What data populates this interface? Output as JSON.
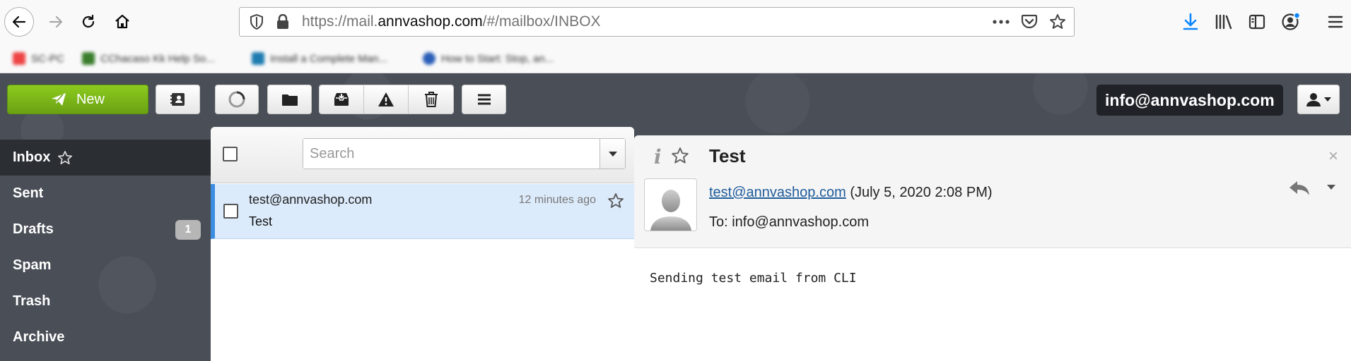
{
  "browser": {
    "url_prefix": "https://mail.",
    "url_domain": "annvashop.com",
    "url_suffix": "/#/mailbox/INBOX",
    "bookmarks": [
      {
        "label": "SC-PC",
        "color": "#e44"
      },
      {
        "label": "CChacaso Kk Help So...",
        "color": "#3a7d2c"
      },
      {
        "label": "Install a Complete Man...",
        "color": "#1d7bb0"
      },
      {
        "label": "How to Start: Stop, an...",
        "color": "#2b5fb8"
      }
    ]
  },
  "toolbar": {
    "new_label": "New",
    "account_email": "info@annvashop.com"
  },
  "sidebar": {
    "folders": [
      {
        "label": "Inbox"
      },
      {
        "label": "Sent"
      },
      {
        "label": "Drafts",
        "badge": "1"
      },
      {
        "label": "Spam"
      },
      {
        "label": "Trash"
      },
      {
        "label": "Archive"
      }
    ]
  },
  "message_list": {
    "search_placeholder": "Search",
    "messages": [
      {
        "from": "test@annvashop.com",
        "subject": "Test",
        "time": "12 minutes ago"
      }
    ]
  },
  "reading_pane": {
    "subject": "Test",
    "sender_email": "test@annvashop.com",
    "date": "(July 5, 2020 2:08 PM)",
    "to_line": "To: info@annvashop.com",
    "body": "Sending test email from CLI",
    "close_glyph": "×"
  },
  "colors": {
    "accent_green": "#7ab317",
    "selection_blue": "#3b8de0",
    "app_background": "#4a4f57"
  }
}
